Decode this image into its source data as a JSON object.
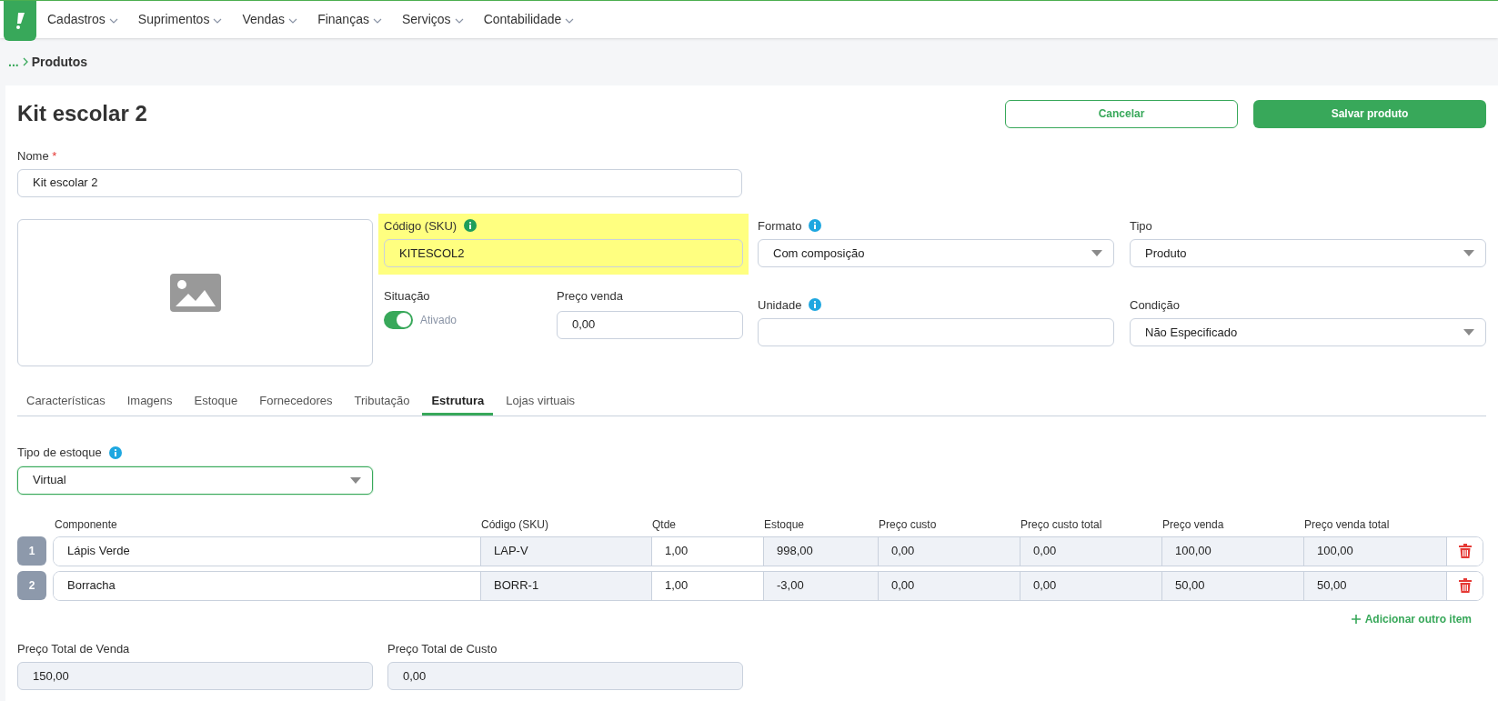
{
  "nav": {
    "menus": [
      {
        "label": "Cadastros"
      },
      {
        "label": "Suprimentos"
      },
      {
        "label": "Vendas"
      },
      {
        "label": "Finanças"
      },
      {
        "label": "Serviços"
      },
      {
        "label": "Contabilidade"
      }
    ]
  },
  "breadcrumb": {
    "ellipsis": "...",
    "current": "Produtos"
  },
  "header": {
    "title": "Kit escolar 2",
    "buttons": [
      {
        "label": "Cancelar",
        "kind": "outline"
      },
      {
        "label": "Salvar produto",
        "kind": "primary"
      }
    ]
  },
  "name_field": {
    "label": "Nome",
    "required_mark": "*",
    "value": "Kit escolar 2"
  },
  "sku": {
    "label": "Código (SKU)",
    "value": "KITESCOL2",
    "highlighted": true
  },
  "formato": {
    "label": "Formato",
    "value": "Com composição"
  },
  "tipo": {
    "label": "Tipo",
    "value": "Produto"
  },
  "situacao": {
    "label": "Situação",
    "on": true,
    "status": "Ativado"
  },
  "preco_venda": {
    "label": "Preço venda",
    "value": "0,00"
  },
  "unidade": {
    "label": "Unidade"
  },
  "condicao": {
    "label": "Condição",
    "value": "Não Especificado"
  },
  "tabs": [
    {
      "label": "Características",
      "selected": false
    },
    {
      "label": "Imagens",
      "selected": false
    },
    {
      "label": "Estoque",
      "selected": false
    },
    {
      "label": "Fornecedores",
      "selected": false
    },
    {
      "label": "Tributação",
      "selected": false
    },
    {
      "label": "Estrutura",
      "selected": true
    },
    {
      "label": "Lojas virtuais",
      "selected": false
    }
  ],
  "stock_type": {
    "label": "Tipo de estoque",
    "value": "Virtual"
  },
  "table": {
    "columns": [
      "Componente",
      "Código (SKU)",
      "Qtde",
      "Estoque",
      "Preço custo",
      "Preço custo total",
      "Preço venda",
      "Preço venda total"
    ],
    "rows": [
      {
        "number": "1",
        "cells": [
          "Lápis Verde",
          "LAP-V",
          "1,00",
          "998,00",
          "0,00",
          "0,00",
          "100,00",
          "100,00"
        ]
      },
      {
        "number": "2",
        "cells": [
          "Borracha",
          "BORR-1",
          "1,00",
          "-3,00",
          "0,00",
          "0,00",
          "50,00",
          "50,00"
        ]
      }
    ],
    "add_item": "Adicionar outro item"
  },
  "totals": [
    {
      "label": "Preço Total de Venda",
      "value": "150,00"
    },
    {
      "label": "Preço Total de Custo",
      "value": "0,00"
    }
  ]
}
